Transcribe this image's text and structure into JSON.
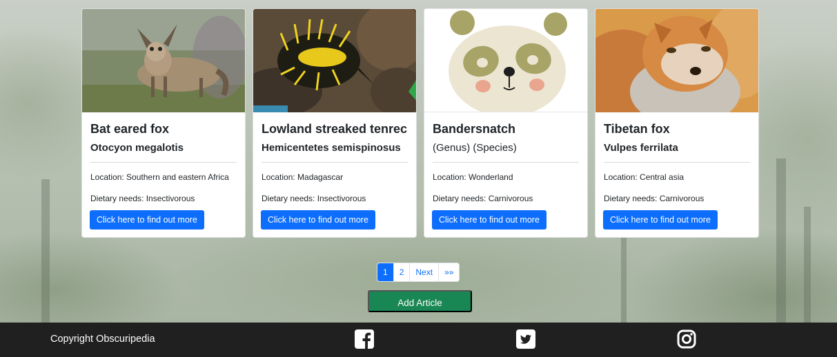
{
  "cards": [
    {
      "title": "Bat eared fox",
      "species": "Otocyon megalotis",
      "location": "Location: Southern and eastern Africa",
      "diet": "Dietary needs: Insectivorous",
      "button": "Click here to find out more",
      "image": "bat-eared-fox-photo"
    },
    {
      "title": "Lowland streaked tenrec",
      "species": "Hemicentetes semispinosus",
      "location": "Location: Madagascar",
      "diet": "Dietary needs: Insectivorous",
      "button": "Click here to find out more",
      "image": "tenrec-photo"
    },
    {
      "title": "Bandersnatch",
      "species": "(Genus) (Species)",
      "location": "Location: Wonderland",
      "diet": "Dietary needs: Carnivorous",
      "button": "Click here to find out more",
      "image": "panda-illustration"
    },
    {
      "title": "Tibetan fox",
      "species": "Vulpes ferrilata",
      "location": "Location: Central asia",
      "diet": "Dietary needs: Carnivorous",
      "button": "Click here to find out more",
      "image": "tibetan-fox-photo"
    }
  ],
  "pagination": {
    "items": [
      "1",
      "2",
      "Next",
      "»»"
    ],
    "active": "1"
  },
  "add_article": "Add Article",
  "footer": {
    "copyright": "Copyright Obscuripedia",
    "icons": [
      "facebook-icon",
      "twitter-icon",
      "instagram-icon"
    ]
  },
  "colors": {
    "primary": "#0d6efd",
    "success": "#198754",
    "footer_bg": "#202020"
  }
}
